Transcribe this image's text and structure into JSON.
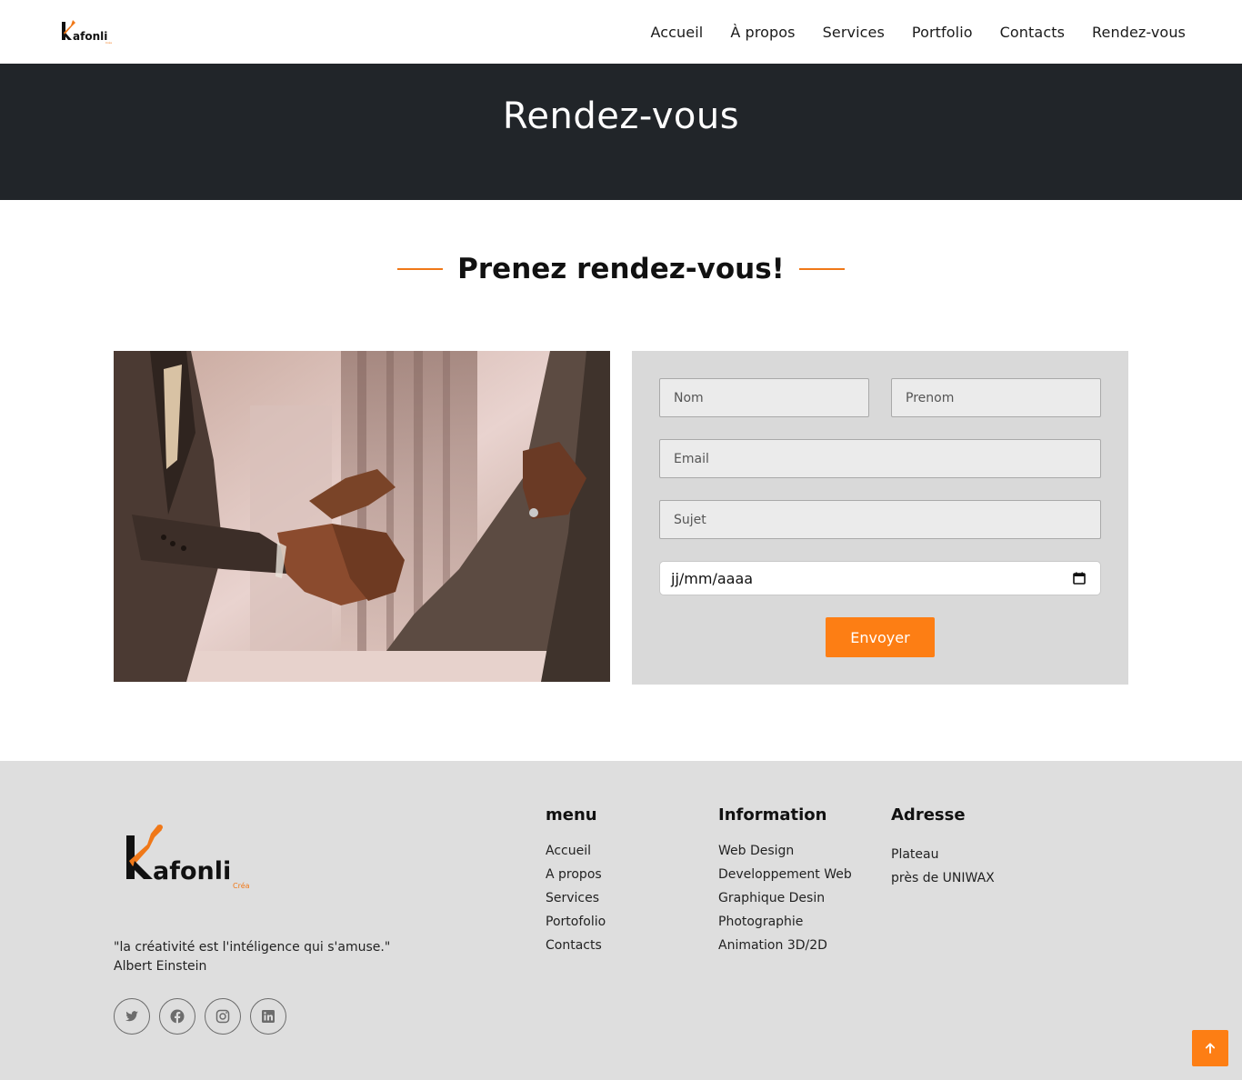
{
  "header": {
    "logo_text": "Kafonli",
    "logo_sub": "Créa",
    "nav": [
      "Accueil",
      "À propos",
      "Services",
      "Portfolio",
      "Contacts",
      "Rendez-vous"
    ]
  },
  "hero": {
    "title": "Rendez-vous"
  },
  "section": {
    "title": "Prenez rendez-vous!"
  },
  "form": {
    "nom_placeholder": "Nom",
    "prenom_placeholder": "Prenom",
    "email_placeholder": "Email",
    "sujet_placeholder": "Sujet",
    "date_value": "jj/mm/aaaa",
    "submit_label": "Envoyer"
  },
  "footer": {
    "logo_text": "Kafonli",
    "logo_sub": "Créa",
    "quote_line1": "\"la créativité est l'intéligence qui s'amuse.\"",
    "quote_line2": "Albert Einstein",
    "socials": [
      "twitter-icon",
      "facebook-icon",
      "instagram-icon",
      "linkedin-icon"
    ],
    "menu": {
      "title": "menu",
      "items": [
        "Accueil",
        "A propos",
        "Services",
        "Portofolio",
        "Contacts"
      ]
    },
    "information": {
      "title": "Information",
      "items": [
        "Web Design",
        "Developpement Web",
        "Graphique Desin",
        "Photographie",
        "Animation 3D/2D"
      ]
    },
    "adresse": {
      "title": "Adresse",
      "lines": [
        "Plateau",
        "près de UNIWAX"
      ]
    }
  },
  "colors": {
    "accent": "#fd7e14",
    "hero_bg": "#212529",
    "form_bg": "#d9d9d9",
    "footer_bg": "#dedede"
  }
}
